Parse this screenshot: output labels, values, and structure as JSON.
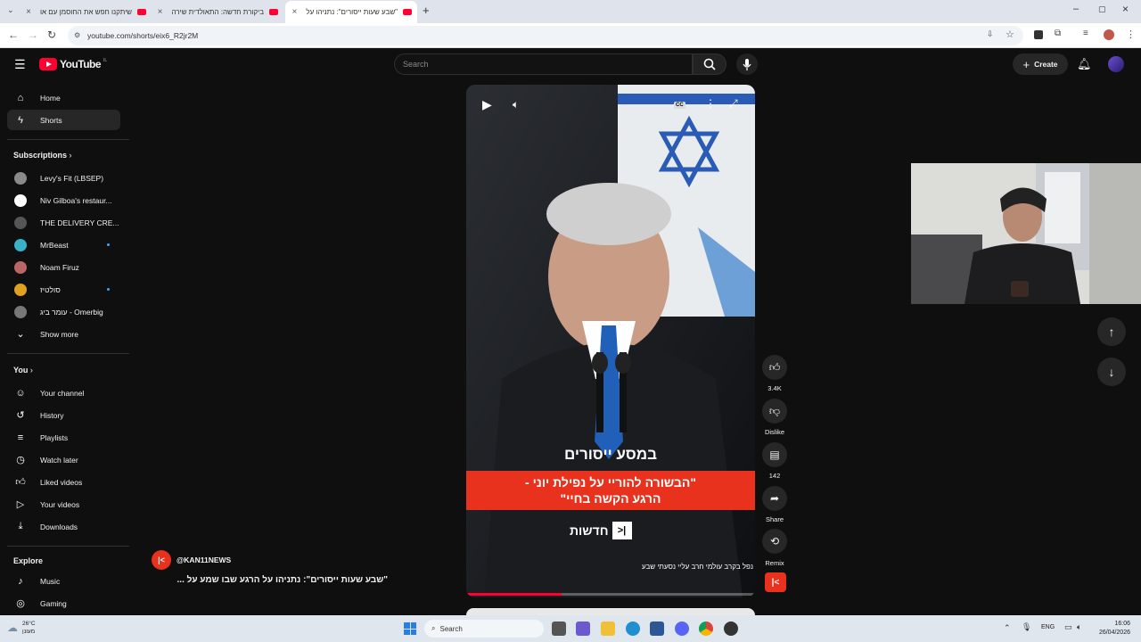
{
  "browser": {
    "tabs": [
      {
        "title": "שיתקנו חפש את החוסמן עם או"
      },
      {
        "title": "ביקורת חדשה: התאולדית שירה"
      },
      {
        "title": "\"שבע שעות ייסורים\": נתניהו על"
      }
    ],
    "url": "youtube.com/shorts/eix6_R2jr2M"
  },
  "youtube": {
    "logo_text": "YouTube",
    "logo_region": "IL",
    "search_placeholder": "Search",
    "create_label": "Create",
    "sidebar": {
      "main": [
        {
          "label": "Home"
        },
        {
          "label": "Shorts"
        }
      ],
      "subscriptions_heading": "Subscriptions",
      "subscriptions": [
        {
          "label": "Levy's Fit (LBSEP)"
        },
        {
          "label": "Niv Gilboa's restaur..."
        },
        {
          "label": "THE DELIVERY CRE..."
        },
        {
          "label": "MrBeast"
        },
        {
          "label": "Noam Firuz"
        },
        {
          "label": "סולטיז"
        },
        {
          "label": "עומר ביג - Omerbig"
        }
      ],
      "show_more": "Show more",
      "you_heading": "You",
      "you_items": [
        {
          "label": "Your channel"
        },
        {
          "label": "History"
        },
        {
          "label": "Playlists"
        },
        {
          "label": "Watch later"
        },
        {
          "label": "Liked videos"
        },
        {
          "label": "Your videos"
        },
        {
          "label": "Downloads"
        }
      ],
      "explore_heading": "Explore",
      "explore_items": [
        {
          "label": "Music"
        },
        {
          "label": "Gaming"
        }
      ]
    },
    "short": {
      "channel": "@KAN11NEWS",
      "title": "\"שבע שעות ייסורים\": נתניהו על הרגע שבו שמע על ...",
      "caption_top": "במסע ייסורים",
      "caption_quote_line1": "\"הבשורה להוריי על נפילת יוני -",
      "caption_quote_line2": "הרגע הקשה בחיי\"",
      "brand_label": "חדשות",
      "subtitle": "נפל בקרב עולמי חרב עליי נסעתי שבע",
      "cc_label": "CC",
      "like_count": "3.4K",
      "dislike_label": "Dislike",
      "comment_count": "142",
      "share_label": "Share",
      "remix_label": "Remix",
      "progress": 0.33
    }
  },
  "taskbar": {
    "weather_temp": "26°C",
    "weather_desc": "מעונן",
    "search_label": "Search",
    "lang": "ENG",
    "time": "16:06",
    "date": "26/04/2026"
  }
}
